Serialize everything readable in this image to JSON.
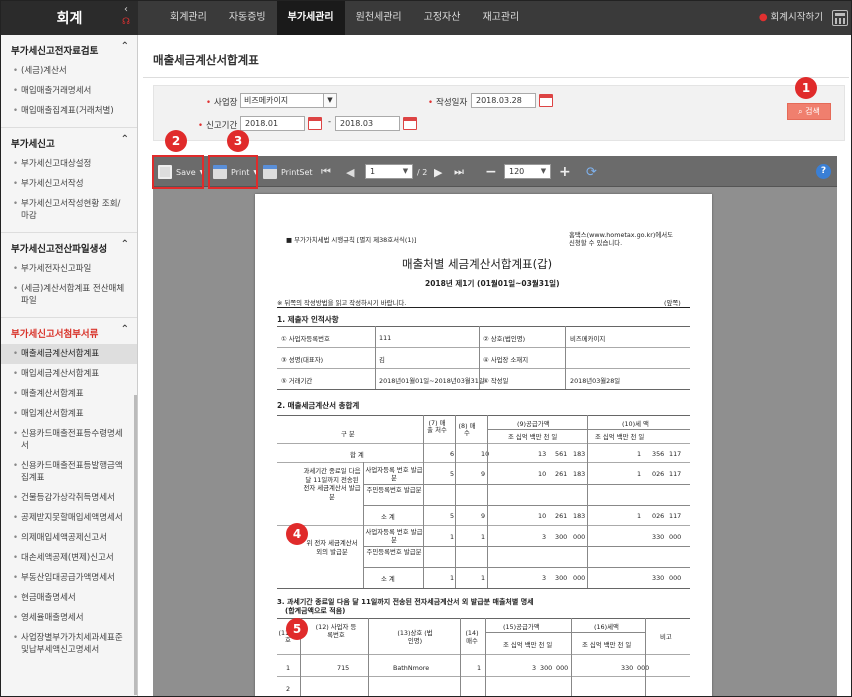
{
  "app": {
    "title": "회계"
  },
  "nav": {
    "tabs": [
      "회계관리",
      "자동증빙",
      "부가세관리",
      "원천세관리",
      "고정자산",
      "재고관리"
    ],
    "active": 2,
    "right_label": "회계시작하기"
  },
  "sidebar": {
    "sections": [
      {
        "title": "부가세신고전자료검토",
        "items": [
          "(세금)계산서",
          "매입매출거래명세서",
          "매입매출집계표(거래처별)"
        ]
      },
      {
        "title": "부가세신고",
        "items": [
          "부가세신고대상설정",
          "부가세신고서작성",
          "부가세신고서작성현황 조회/마감"
        ]
      },
      {
        "title": "부가세신고전산파일생성",
        "items": [
          "부가세전자신고파일",
          "(세금)계산서합계표 전산매체파일"
        ]
      },
      {
        "title": "부가세신고서첨부서류",
        "items": [
          "매출세금계산서합계표",
          "매입세금계산서합계표",
          "매출계산서합계표",
          "매입계산서합계표",
          "신용카드매출전표등수령명세서",
          "신용카드매출전표등발행금액집계표",
          "건물등감가상각취득명세서",
          "공제받지못할매입세액명세서",
          "의제매입세액공제신고서",
          "대손세액공제(변제)신고서",
          "부동산임대공급가액명세서",
          "현금매출명세서",
          "영세율매출명세서",
          "사업장별부가가치세과세표준및납부세액신고명세서"
        ]
      }
    ],
    "active_item": "매출세금계산서합계표"
  },
  "main": {
    "title": "매출세금계산서합계표",
    "search": {
      "biz_label": "사업장",
      "biz_value": "비즈메카이지",
      "write_label": "작성일자",
      "write_value": "2018.03.28",
      "period_label": "신고기간",
      "period_from": "2018.01",
      "period_sep": "-",
      "period_to": "2018.03",
      "search_button": "검색"
    },
    "viewer": {
      "save_label": "Save",
      "print_label": "Print",
      "printset_label": "PrintSet",
      "page_current": "1",
      "page_total": "/ 2",
      "zoom": "120",
      "help": "?"
    }
  },
  "doc": {
    "form_ref": "■ 부가가치세법 시행규칙 [별지 제38호서식(1)]",
    "hometax_note": "홈택스(www.hometax.go.kr)에서도 신청할 수 있습니다.",
    "title": "매출처별 세금계산서합계표(갑)",
    "period": "2018년 제1기 (01월01일~03월31일)",
    "instruction": "※ 뒤쪽의 작성방법을 읽고 작성하시기 바랍니다.",
    "page_side": "(앞쪽)",
    "s1_title": "1. 제출자 인적사항",
    "s1": {
      "r1a": "① 사업자등록번호",
      "r1b": "111",
      "r1c": "② 상호(법인명)",
      "r1d": "비즈메카이지",
      "r2a": "③ 성명(대표자)",
      "r2b": "김",
      "r2c": "④ 사업장 소재지",
      "r3a": "⑤ 거래기간",
      "r3b": "2018년01월01일~2018년03월31일",
      "r3c": "⑥ 작성일",
      "r3d": "2018년03월28일"
    },
    "s2_title": "2. 매출세금계산서 총합계",
    "s2": {
      "h_gubun": "구 분",
      "h_count": "(7) 매출 처수",
      "h_sheets": "(8) 매수",
      "h_supply": "(9)공급가액",
      "h_tax": "(10)세 액",
      "units": "조 십억 백만 천 일",
      "total": "합 계",
      "total_vals": [
        "6",
        "10",
        "13",
        "561",
        "183",
        "1",
        "356",
        "117"
      ],
      "grp1": "과세기간 종료일 다음 달 11일까지 전송된 전자 세금계산서 발급분",
      "g1r1": "사업자등록 번호 발급분",
      "g1r1_vals": [
        "5",
        "9",
        "10",
        "261",
        "183",
        "1",
        "026",
        "117"
      ],
      "g1r2": "주민등록번호 발급분",
      "g1r3": "소 계",
      "g1r3_vals": [
        "5",
        "9",
        "10",
        "261",
        "183",
        "1",
        "026",
        "117"
      ],
      "grp2": "위 전자 세금계산서 외의 발급분",
      "g2r1": "사업자등록 번호 발급분",
      "g2r1_vals": [
        "1",
        "1",
        "3",
        "300",
        "000",
        "330",
        "000"
      ],
      "g2r2": "주민등록번호 발급분",
      "g2r3": "소 계",
      "g2r3_vals": [
        "1",
        "1",
        "3",
        "300",
        "000",
        "330",
        "000"
      ]
    },
    "s3_title": "3. 과세기간 종료일 다음 달 11일까지 전송된 전자세금계산서 외 발급분 매출처별 명세",
    "s3_sub": "(합계금액으로 적음)",
    "s3": {
      "h_no": "(11)번 호",
      "h_reg": "(12) 사업자 등록번호",
      "h_name": "(13)상호 (법인명)",
      "h_sheets": "(14) 매수",
      "h_supply": "(15)공급가액",
      "h_tax": "(16)세액",
      "h_note": "비고",
      "row1": [
        "1",
        "715",
        "BathNmore",
        "1",
        "3",
        "300",
        "000",
        "330",
        "000"
      ],
      "row2_no": "2"
    }
  },
  "badges": [
    "1",
    "2",
    "3",
    "4",
    "5"
  ]
}
